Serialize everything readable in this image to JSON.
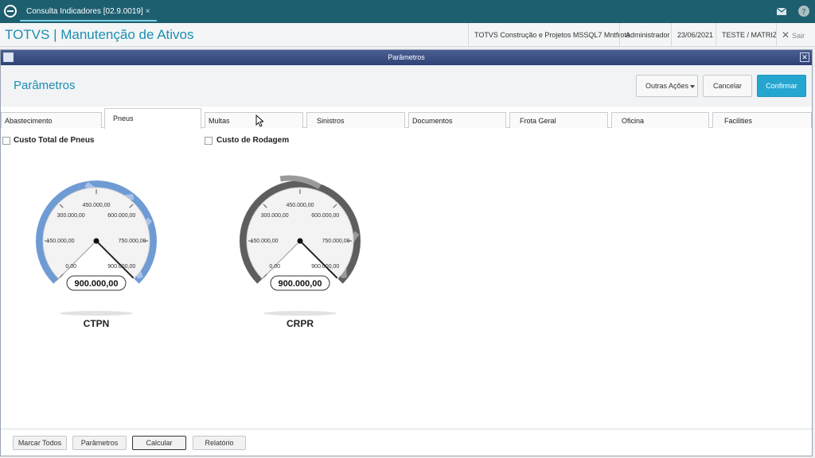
{
  "topbar": {
    "tab_label": "Consulta Indicadores [02.9.0019]",
    "tab_close": "×",
    "icons": [
      "totvs-logo-icon",
      "mail-icon",
      "help-icon"
    ]
  },
  "titlebar": {
    "title": "TOTVS | Manutenção de Ativos",
    "company": "TOTVS Construção e Projetos MSSQL7 Mntfrota",
    "user": "Administrador",
    "date": "23/06/2021",
    "branch": "TESTE / MATRIZ",
    "exit_label": "Sair"
  },
  "dialog": {
    "window_title": "Parâmetros",
    "heading": "Parâmetros",
    "buttons": {
      "other_actions": "Outras Ações",
      "cancel": "Cancelar",
      "confirm": "Confirmar"
    },
    "tabs": [
      "Abastecimento",
      "Pneus",
      "Multas",
      "Sinistros",
      "Documentos",
      "Frota Geral",
      "Oficina",
      "Facilities"
    ],
    "active_tab": "Pneus",
    "checkboxes": [
      {
        "label": "Custo Total de Pneus",
        "checked": false
      },
      {
        "label": "Custo de Rodagem",
        "checked": false
      }
    ],
    "gauges": [
      {
        "id": "CTPN",
        "label": "CTPN",
        "value_text": "900.000,00",
        "value": 900000,
        "style": "blue",
        "ticks": [
          "0,00",
          "150.000,00",
          "300.000,00",
          "450.000,00",
          "600.000,00",
          "750.000,00",
          "900.000,00"
        ]
      },
      {
        "id": "CRPR",
        "label": "CRPR",
        "value_text": "900.000,00",
        "value": 900000,
        "style": "gray",
        "ticks": [
          "0,00",
          "150.000,00",
          "300.000,00",
          "450.000,00",
          "600.000,00",
          "750.000,00",
          "900.000,00"
        ]
      }
    ],
    "footer_buttons": [
      "Marcar Todos",
      "Parâmetros",
      "Calcular",
      "Relatório"
    ],
    "focused_footer_button": "Calcular"
  },
  "colors": {
    "brand_bar": "#1d5e6f",
    "title_accent": "#1a8fb3",
    "confirm": "#25a6d1",
    "dialog_header": "#34487b"
  }
}
